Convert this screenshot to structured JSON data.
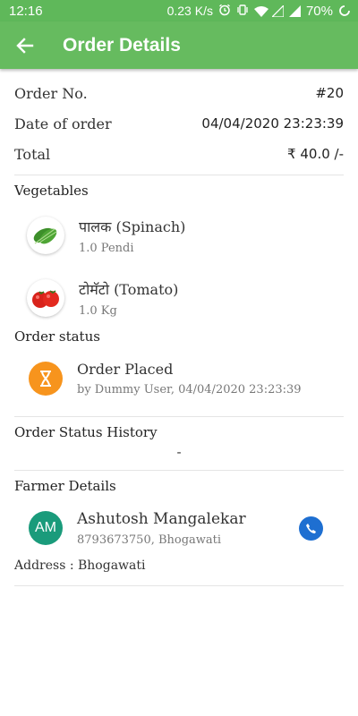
{
  "status_bar": {
    "time": "12:16",
    "network_speed": "0.23 K/s",
    "battery": "70%",
    "icons": [
      "alarm-icon",
      "vibrate-icon",
      "wifi-icon",
      "signal-icon",
      "signal-icon",
      "battery-icon",
      "rotate-icon"
    ]
  },
  "app_bar": {
    "title": "Order Details",
    "back_icon": "arrow-back-icon"
  },
  "order": {
    "number_label": "Order No.",
    "number_value": "#20",
    "date_label": "Date of order",
    "date_value": "04/04/2020 23:23:39",
    "total_label": "Total",
    "total_value": "₹ 40.0 /-"
  },
  "vegetables": {
    "label": "Vegetables",
    "items": [
      {
        "name": "पालक (Spinach)",
        "qty": "1.0 Pendi",
        "icon": "spinach-icon"
      },
      {
        "name": "टोमॅटो (Tomato)",
        "qty": "1.0 Kg",
        "icon": "tomato-icon"
      }
    ]
  },
  "order_status": {
    "label": "Order status",
    "status": "Order Placed",
    "detail": "by Dummy User, 04/04/2020 23:23:39",
    "icon": "hourglass-icon",
    "color": "#f7941d"
  },
  "status_history": {
    "label": "Order Status History",
    "value": "-"
  },
  "farmer": {
    "label": "Farmer Details",
    "initials": "AM",
    "name": "Ashutosh Mangalekar",
    "contact": "8793673750, Bhogawati",
    "address": "Address : Bhogawati",
    "call_icon": "phone-icon"
  },
  "colors": {
    "app_bar": "#66bb5f",
    "status_bar": "#5fb85a",
    "avatar": "#1a9b7b",
    "call_button": "#1e6fd1"
  }
}
